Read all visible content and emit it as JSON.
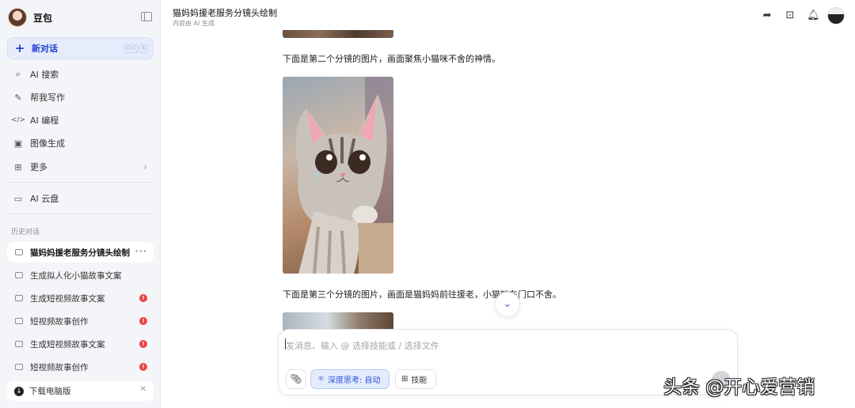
{
  "app": {
    "name": "豆包"
  },
  "sidebar": {
    "new_chat": {
      "label": "新对话",
      "shortcut": [
        "Ctrl",
        "K"
      ]
    },
    "nav": [
      {
        "label": "AI 搜索",
        "icon": "search-spark-icon"
      },
      {
        "label": "帮我写作",
        "icon": "pen-icon"
      },
      {
        "label": "AI 编程",
        "icon": "code-icon"
      },
      {
        "label": "图像生成",
        "icon": "image-icon"
      },
      {
        "label": "更多",
        "icon": "grid-icon"
      }
    ],
    "cloud": {
      "label": "AI 云盘",
      "icon": "folder-icon"
    },
    "history_title": "历史对话",
    "history": [
      {
        "label": "猫妈妈援老服务分镜头绘制",
        "active": true,
        "badge": ""
      },
      {
        "label": "生成拟人化小猫故事文案",
        "active": false,
        "badge": ""
      },
      {
        "label": "生成短视频故事文案",
        "active": false,
        "badge": "!"
      },
      {
        "label": "短视频故事创作",
        "active": false,
        "badge": "!"
      },
      {
        "label": "生成短视频故事文案",
        "active": false,
        "badge": "!"
      },
      {
        "label": "短视频故事创作",
        "active": false,
        "badge": "!"
      }
    ],
    "download": {
      "label": "下载电脑版"
    }
  },
  "header": {
    "title": "猫妈妈援老服务分镜头绘制",
    "subtitle": "内容由 AI 生成"
  },
  "chat": {
    "msg2": "下面是第二个分镜的图片，画面聚焦小猫咪不舍的神情。",
    "msg3": "下面是第三个分镜的图片，画面是猫妈妈前往援老，小猫咪在门口不舍。"
  },
  "composer": {
    "placeholder": "发消息、输入 @ 选择技能或 / 选择文件",
    "deep_think": "深度思考: 自动",
    "skills": "技能"
  },
  "watermark": "头条 @开心爱营销",
  "colors": {
    "accent": "#3b5ee8",
    "badge": "#ee4040",
    "sidebar_bg": "#f4f5f8"
  }
}
